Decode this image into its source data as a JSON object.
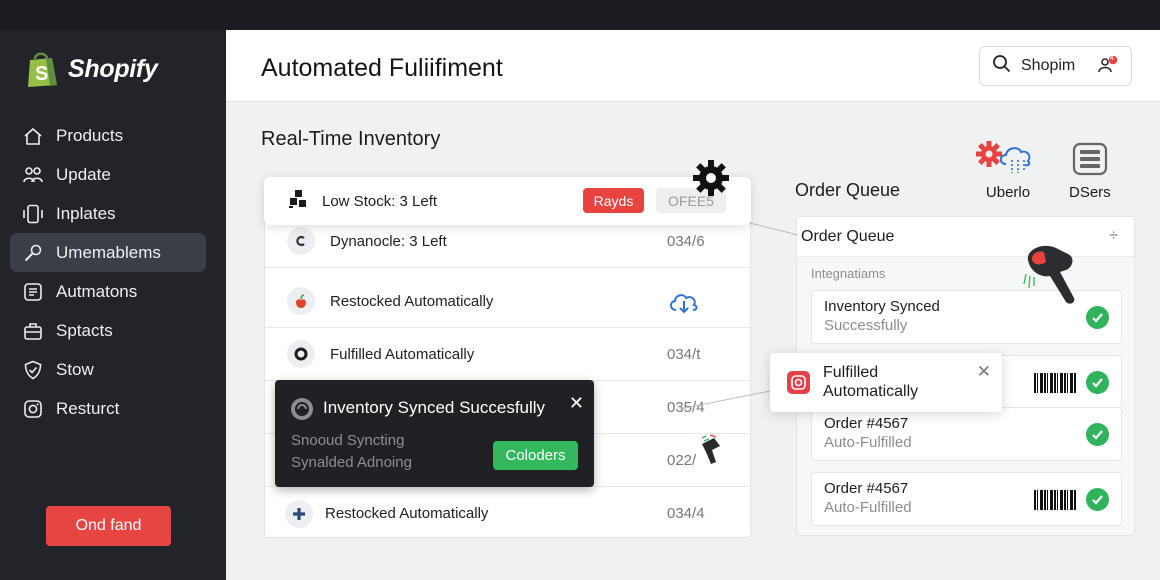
{
  "sidebar": {
    "brand": "Shopify",
    "items": [
      {
        "label": "Products",
        "icon": "home-icon"
      },
      {
        "label": "Update",
        "icon": "users-icon"
      },
      {
        "label": "Inplates",
        "icon": "phone-icon"
      },
      {
        "label": "Umemablems",
        "icon": "wrench-icon",
        "active": true
      },
      {
        "label": "Autmatons",
        "icon": "list-icon"
      },
      {
        "label": "Sptacts",
        "icon": "briefcase-icon"
      },
      {
        "label": "Stow",
        "icon": "shield-icon"
      },
      {
        "label": "Resturct",
        "icon": "instagram-icon"
      }
    ],
    "action_button": "Ond fand"
  },
  "header": {
    "title": "Automated Fuliifiment",
    "search_text": "Shopim",
    "notification_count": "4"
  },
  "inventory": {
    "title": "Real-Time Inventory",
    "highlight": {
      "label": "Low Stock: 3 Left",
      "badge_red": "Rayds",
      "badge_grey": "OFEE5"
    },
    "rows": [
      {
        "label": "Dynanocle: 3 Left",
        "value": "034/6"
      },
      {
        "label": "Restocked Automatically",
        "value": ""
      },
      {
        "label": "Fulfilled Automatically",
        "value": "034/t"
      },
      {
        "label": "",
        "value": "035/4"
      },
      {
        "label": "",
        "value": "022/"
      },
      {
        "label": "Restocked Automatically",
        "value": "034/4"
      }
    ]
  },
  "toast": {
    "title": "Inventory Synced Succesfully",
    "line1": "Snooud Syncting",
    "line2": "Synalded Adnoing",
    "button": "Coloders"
  },
  "order_queue": {
    "title": "Order Queue",
    "card_title": "Order Queue",
    "integrations_label": "Integnatiams",
    "integrations": [
      {
        "name": "Uberlo",
        "icon": "gear-cloud-icon"
      },
      {
        "name": "DSers",
        "icon": "server-icon"
      }
    ],
    "items": [
      {
        "title": "Inventory Synced",
        "subtitle": "Successfully"
      },
      {
        "title": "",
        "subtitle": ""
      },
      {
        "title": "Order #4567",
        "subtitle": "Auto-Fulfilled"
      },
      {
        "title": "Order #4567",
        "subtitle": "Auto-Fulfilled"
      }
    ]
  },
  "popup": {
    "text": "Fulfilled Automatically"
  },
  "colors": {
    "accent_red": "#e8433f",
    "success_green": "#2fb35b",
    "sidebar_bg": "#222429"
  }
}
